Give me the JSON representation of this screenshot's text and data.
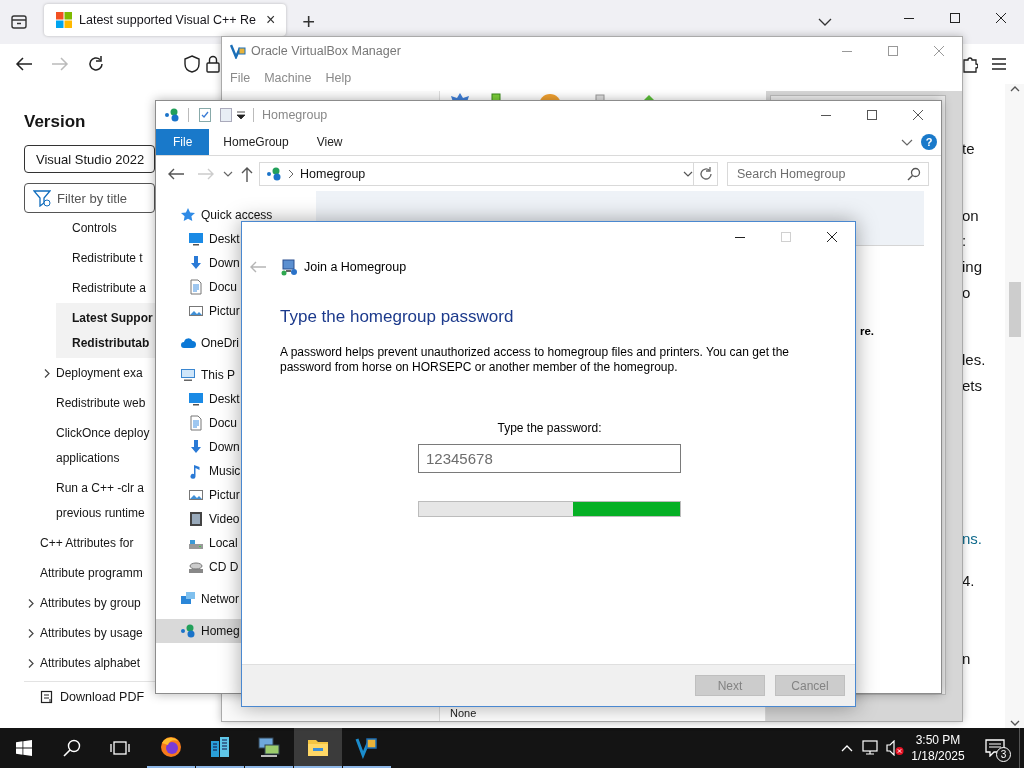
{
  "browser": {
    "tab": {
      "title": "Latest supported Visual C++ Re",
      "close": "×"
    },
    "new_tab": "+",
    "sidebar": {
      "heading": "Version",
      "version": "Visual Studio 2022",
      "filter": {
        "placeholder": "Filter by title"
      },
      "toc": [
        {
          "children": [
            {
              "children": [
                {
                  "kind": "page",
                  "lines": [
                    "Controls"
                  ],
                  "selected": false
                },
                {
                  "kind": "page",
                  "lines": [
                    "Redistribute t"
                  ],
                  "selected": false
                },
                {
                  "kind": "page",
                  "lines": [
                    "Redistribute a"
                  ],
                  "selected": false
                },
                {
                  "kind": "page",
                  "lines": [
                    "Latest Suppor",
                    "Redistributab"
                  ],
                  "selected": true
                }
              ]
            },
            {
              "kind": "folder",
              "lines": [
                "Deployment exa"
              ],
              "selected": false
            },
            {
              "kind": "page",
              "lines": [
                "Redistribute web"
              ],
              "selected": false
            },
            {
              "kind": "page",
              "lines": [
                "ClickOnce deploy",
                "applications"
              ],
              "selected": false
            },
            {
              "kind": "page",
              "lines": [
                "Run a C++ -clr a",
                "previous runtime"
              ],
              "selected": false
            }
          ]
        },
        {
          "kind": "page",
          "lines": [
            "C++ Attributes for"
          ],
          "selected": false
        },
        {
          "kind": "page",
          "lines": [
            "Attribute programm"
          ],
          "selected": false
        },
        {
          "kind": "folder",
          "lines": [
            "Attributes by group"
          ],
          "selected": false
        },
        {
          "kind": "folder",
          "lines": [
            "Attributes by usage"
          ],
          "selected": false
        },
        {
          "kind": "folder",
          "lines": [
            "Attributes alphabet"
          ],
          "selected": false
        }
      ],
      "download": "Download PDF"
    },
    "content_fragments": [
      {
        "kind": "text",
        "text": "te"
      },
      {
        "kind": "text",
        "text": "on"
      },
      {
        "kind": "text",
        "text": ":"
      },
      {
        "kind": "text",
        "text": "ing"
      },
      {
        "kind": "text",
        "text": "o"
      },
      {
        "kind": "text",
        "text": "les."
      },
      {
        "kind": "text",
        "text": "ets"
      },
      {
        "kind": "link",
        "text": "ns."
      },
      {
        "kind": "text",
        "text": "4."
      },
      {
        "kind": "text",
        "text": "n"
      }
    ]
  },
  "virtualbox": {
    "title": "Oracle VirtualBox Manager",
    "menu": [
      "File",
      "Machine",
      "Help"
    ],
    "details_value": "None"
  },
  "explorer": {
    "title": "Homegroup",
    "ribbon_tabs": [
      {
        "label": "File",
        "selected": true
      },
      {
        "label": "HomeGroup",
        "selected": false
      },
      {
        "label": "View",
        "selected": false
      }
    ],
    "help": "?",
    "address": "Homegroup",
    "search": {
      "placeholder": "Search Homegroup"
    },
    "nav": [
      {
        "label": "Quick access",
        "selected": false,
        "children": [
          {
            "label": "Deskt",
            "selected": false
          },
          {
            "label": "Down",
            "selected": false
          },
          {
            "label": "Docu",
            "selected": false
          },
          {
            "label": "Pictur",
            "selected": false
          }
        ]
      },
      {
        "label": "OneDri",
        "selected": false
      },
      {
        "label": "This P",
        "selected": false,
        "children": [
          {
            "label": "Deskt",
            "selected": false
          },
          {
            "label": "Docu",
            "selected": false
          },
          {
            "label": "Down",
            "selected": false
          },
          {
            "label": "Music",
            "selected": false
          },
          {
            "label": "Pictur",
            "selected": false
          },
          {
            "label": "Video",
            "selected": false
          },
          {
            "label": "Local",
            "selected": false
          },
          {
            "label": "CD D",
            "selected": false
          }
        ]
      },
      {
        "label": "Networ",
        "selected": false
      },
      {
        "label": "Homeg",
        "selected": true
      }
    ],
    "content_text": "re."
  },
  "dialog": {
    "title": "Join a Homegroup",
    "back_disabled": true,
    "maximize_disabled": true,
    "heading": "Type the homegroup password",
    "message": "A password helps prevent unauthorized access to homegroup files and printers. You can get the password from horse on HORSEPC or another member of the homegroup.",
    "password_label": "Type the password:",
    "password": {
      "value": "12345678",
      "disabled": true
    },
    "progress": {
      "level": 0.41
    },
    "buttons": [
      {
        "label": "Next",
        "disabled": true
      },
      {
        "label": "Cancel",
        "disabled": true
      }
    ]
  },
  "taskbar": {
    "apps": [
      {
        "selected": false
      },
      {
        "selected": false
      },
      {
        "selected": false
      },
      {
        "selected": true
      },
      {
        "selected": false
      }
    ],
    "volume_muted": true,
    "time": "3:50 PM",
    "date": "1/18/2025",
    "notifications": "3"
  }
}
